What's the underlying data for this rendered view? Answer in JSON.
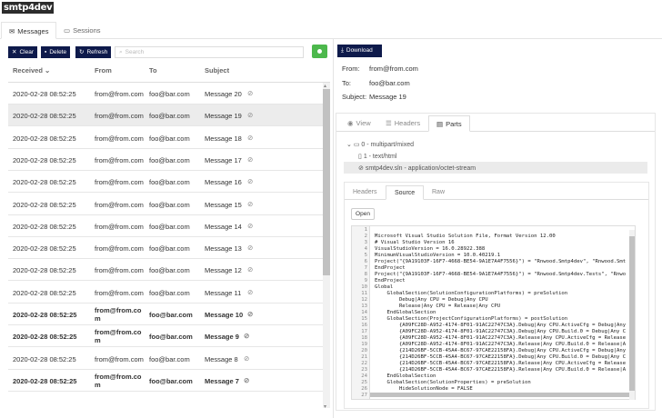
{
  "app": {
    "logo": "smtp4dev"
  },
  "tabs": [
    {
      "label": "Messages",
      "icon": "envelope-icon"
    },
    {
      "label": "Sessions",
      "icon": "chat-icon"
    }
  ],
  "toolbar": {
    "clear_label": "Clear",
    "delete_label": "Delete",
    "refresh_label": "Refresh",
    "search_placeholder": "Search",
    "download_label": "Download"
  },
  "table": {
    "headers": {
      "received": "Received",
      "from": "From",
      "to": "To",
      "subject": "Subject"
    },
    "rows": [
      {
        "received": "2020-02-28 08:52:25",
        "from": "from@from.com",
        "to": "foo@bar.com",
        "subject": "Message 20",
        "bold": false,
        "selected": false
      },
      {
        "received": "2020-02-28 08:52:25",
        "from": "from@from.com",
        "to": "foo@bar.com",
        "subject": "Message 19",
        "bold": false,
        "selected": true
      },
      {
        "received": "2020-02-28 08:52:25",
        "from": "from@from.com",
        "to": "foo@bar.com",
        "subject": "Message 18",
        "bold": false,
        "selected": false
      },
      {
        "received": "2020-02-28 08:52:25",
        "from": "from@from.com",
        "to": "foo@bar.com",
        "subject": "Message 17",
        "bold": false,
        "selected": false
      },
      {
        "received": "2020-02-28 08:52:25",
        "from": "from@from.com",
        "to": "foo@bar.com",
        "subject": "Message 16",
        "bold": false,
        "selected": false
      },
      {
        "received": "2020-02-28 08:52:25",
        "from": "from@from.com",
        "to": "foo@bar.com",
        "subject": "Message 15",
        "bold": false,
        "selected": false
      },
      {
        "received": "2020-02-28 08:52:25",
        "from": "from@from.com",
        "to": "foo@bar.com",
        "subject": "Message 14",
        "bold": false,
        "selected": false
      },
      {
        "received": "2020-02-28 08:52:25",
        "from": "from@from.com",
        "to": "foo@bar.com",
        "subject": "Message 13",
        "bold": false,
        "selected": false
      },
      {
        "received": "2020-02-28 08:52:25",
        "from": "from@from.com",
        "to": "foo@bar.com",
        "subject": "Message 12",
        "bold": false,
        "selected": false
      },
      {
        "received": "2020-02-28 08:52:25",
        "from": "from@from.com",
        "to": "foo@bar.com",
        "subject": "Message 11",
        "bold": false,
        "selected": false
      },
      {
        "received": "2020-02-28 08:52:25",
        "from": "from@from.com",
        "to": "foo@bar.com",
        "subject": "Message 10",
        "bold": true,
        "selected": false
      },
      {
        "received": "2020-02-28 08:52:25",
        "from": "from@from.com",
        "to": "foo@bar.com",
        "subject": "Message 9",
        "bold": true,
        "selected": false
      },
      {
        "received": "2020-02-28 08:52:25",
        "from": "from@from.com",
        "to": "foo@bar.com",
        "subject": "Message 8",
        "bold": false,
        "selected": false
      },
      {
        "received": "2020-02-28 08:52:25",
        "from": "from@from.com",
        "to": "foo@bar.com",
        "subject": "Message 7",
        "bold": true,
        "selected": false
      }
    ]
  },
  "message": {
    "from_label": "From:",
    "from": "from@from.com",
    "to_label": "To:",
    "to": "foo@bar.com",
    "subject_label": "Subject:",
    "subject": "Message 19"
  },
  "detail_tabs": [
    "View",
    "Headers",
    "Parts"
  ],
  "parts_tree": [
    "0 - multipart/mixed",
    "1 - text/html",
    "smtp4dev.sln - application/octet-stream"
  ],
  "source_tabs": [
    "Headers",
    "Source",
    "Raw"
  ],
  "open_label": "Open",
  "code_lines": [
    {
      "n": "1",
      "t": ""
    },
    {
      "n": "2",
      "t": "Microsoft Visual Studio Solution File, Format Version 12.00"
    },
    {
      "n": "3",
      "t": "# Visual Studio Version 16"
    },
    {
      "n": "4",
      "t": "VisualStudioVersion = 16.0.28922.388"
    },
    {
      "n": "5",
      "t": "MinimumVisualStudioVersion = 10.0.40219.1"
    },
    {
      "n": "6",
      "t": "Project(\"{9A19103F-16F7-4668-BE54-9A1E7A4F7556}\") = \"Rnwood.Smtp4dev\", \"Rnwood.Smt"
    },
    {
      "n": "7",
      "t": "EndProject"
    },
    {
      "n": "8",
      "t": "Project(\"{9A19103F-16F7-4668-BE54-9A1E7A4F7556}\") = \"Rnwood.Smtp4dev.Tests\", \"Rnwo"
    },
    {
      "n": "9",
      "t": "EndProject"
    },
    {
      "n": "10",
      "t": "Global"
    },
    {
      "n": "11",
      "t": "    GlobalSection(SolutionConfigurationPlatforms) = preSolution"
    },
    {
      "n": "12",
      "t": "        Debug|Any CPU = Debug|Any CPU"
    },
    {
      "n": "13",
      "t": "        Release|Any CPU = Release|Any CPU"
    },
    {
      "n": "14",
      "t": "    EndGlobalSection"
    },
    {
      "n": "15",
      "t": "    GlobalSection(ProjectConfigurationPlatforms) = postSolution"
    },
    {
      "n": "16",
      "t": "        {A09FC28D-A952-4174-8F01-91AC22747C3A}.Debug|Any CPU.ActiveCfg = Debug|Any"
    },
    {
      "n": "17",
      "t": "        {A09FC28D-A952-4174-8F01-91AC22747C3A}.Debug|Any CPU.Build.0 = Debug|Any C"
    },
    {
      "n": "18",
      "t": "        {A09FC28D-A952-4174-8F01-91AC22747C3A}.Release|Any CPU.ActiveCfg = Release"
    },
    {
      "n": "19",
      "t": "        {A09FC28D-A952-4174-8F01-91AC22747C3A}.Release|Any CPU.Build.0 = Release|A"
    },
    {
      "n": "20",
      "t": "        {214D26BF-5CCB-45A4-BC67-97CAE22158FA}.Debug|Any CPU.ActiveCfg = Debug|Any"
    },
    {
      "n": "21",
      "t": "        {214D26BF-5CCB-45A4-BC67-97CAE22158FA}.Debug|Any CPU.Build.0 = Debug|Any C"
    },
    {
      "n": "22",
      "t": "        {214D26BF-5CCB-45A4-BC67-97CAE22158FA}.Release|Any CPU.ActiveCfg = Release"
    },
    {
      "n": "23",
      "t": "        {214D26BF-5CCB-45A4-BC67-97CAE22158FA}.Release|Any CPU.Build.0 = Release|A"
    },
    {
      "n": "24",
      "t": "    EndGlobalSection"
    },
    {
      "n": "25",
      "t": "    GlobalSection(SolutionProperties) = preSolution"
    },
    {
      "n": "26",
      "t": "        HideSolutionNode = FALSE"
    },
    {
      "n": "27",
      "t": ""
    }
  ],
  "colors": {
    "accent": "#0e1a4b",
    "green": "#4cb84c",
    "selected_row": "#ececec"
  }
}
